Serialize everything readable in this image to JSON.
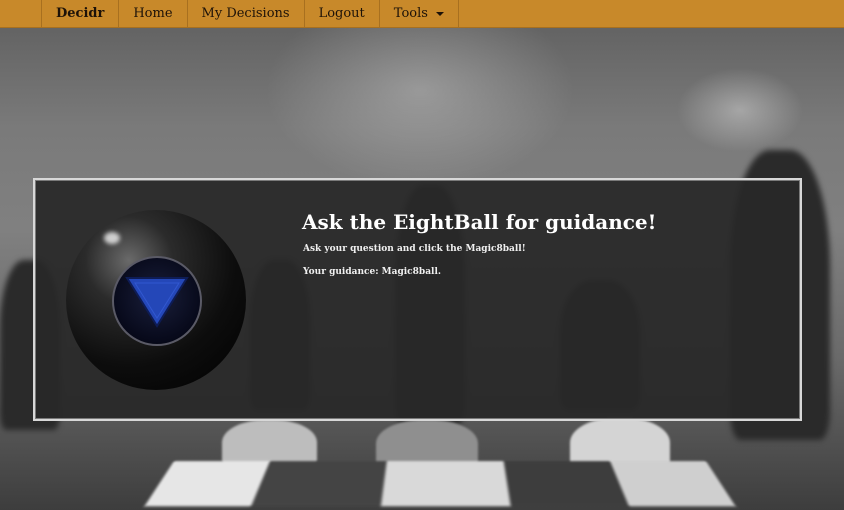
{
  "navbar": {
    "brand": "Decidr",
    "items": [
      {
        "label": "Home"
      },
      {
        "label": "My Decisions"
      },
      {
        "label": "Logout"
      },
      {
        "label": "Tools"
      }
    ]
  },
  "panel": {
    "title": "Ask the EightBall for guidance!",
    "instruction": "Ask your question and click the Magic8ball!",
    "guidance_label": "Your guidance:",
    "guidance_value": "Magic8ball."
  },
  "colors": {
    "navbar": "#c8892a",
    "panel": "#282828",
    "ball_triangle": "#2447b8"
  },
  "icons": {
    "eight_ball": "magic-8-ball-icon",
    "tools_dropdown": "caret-down-icon"
  }
}
